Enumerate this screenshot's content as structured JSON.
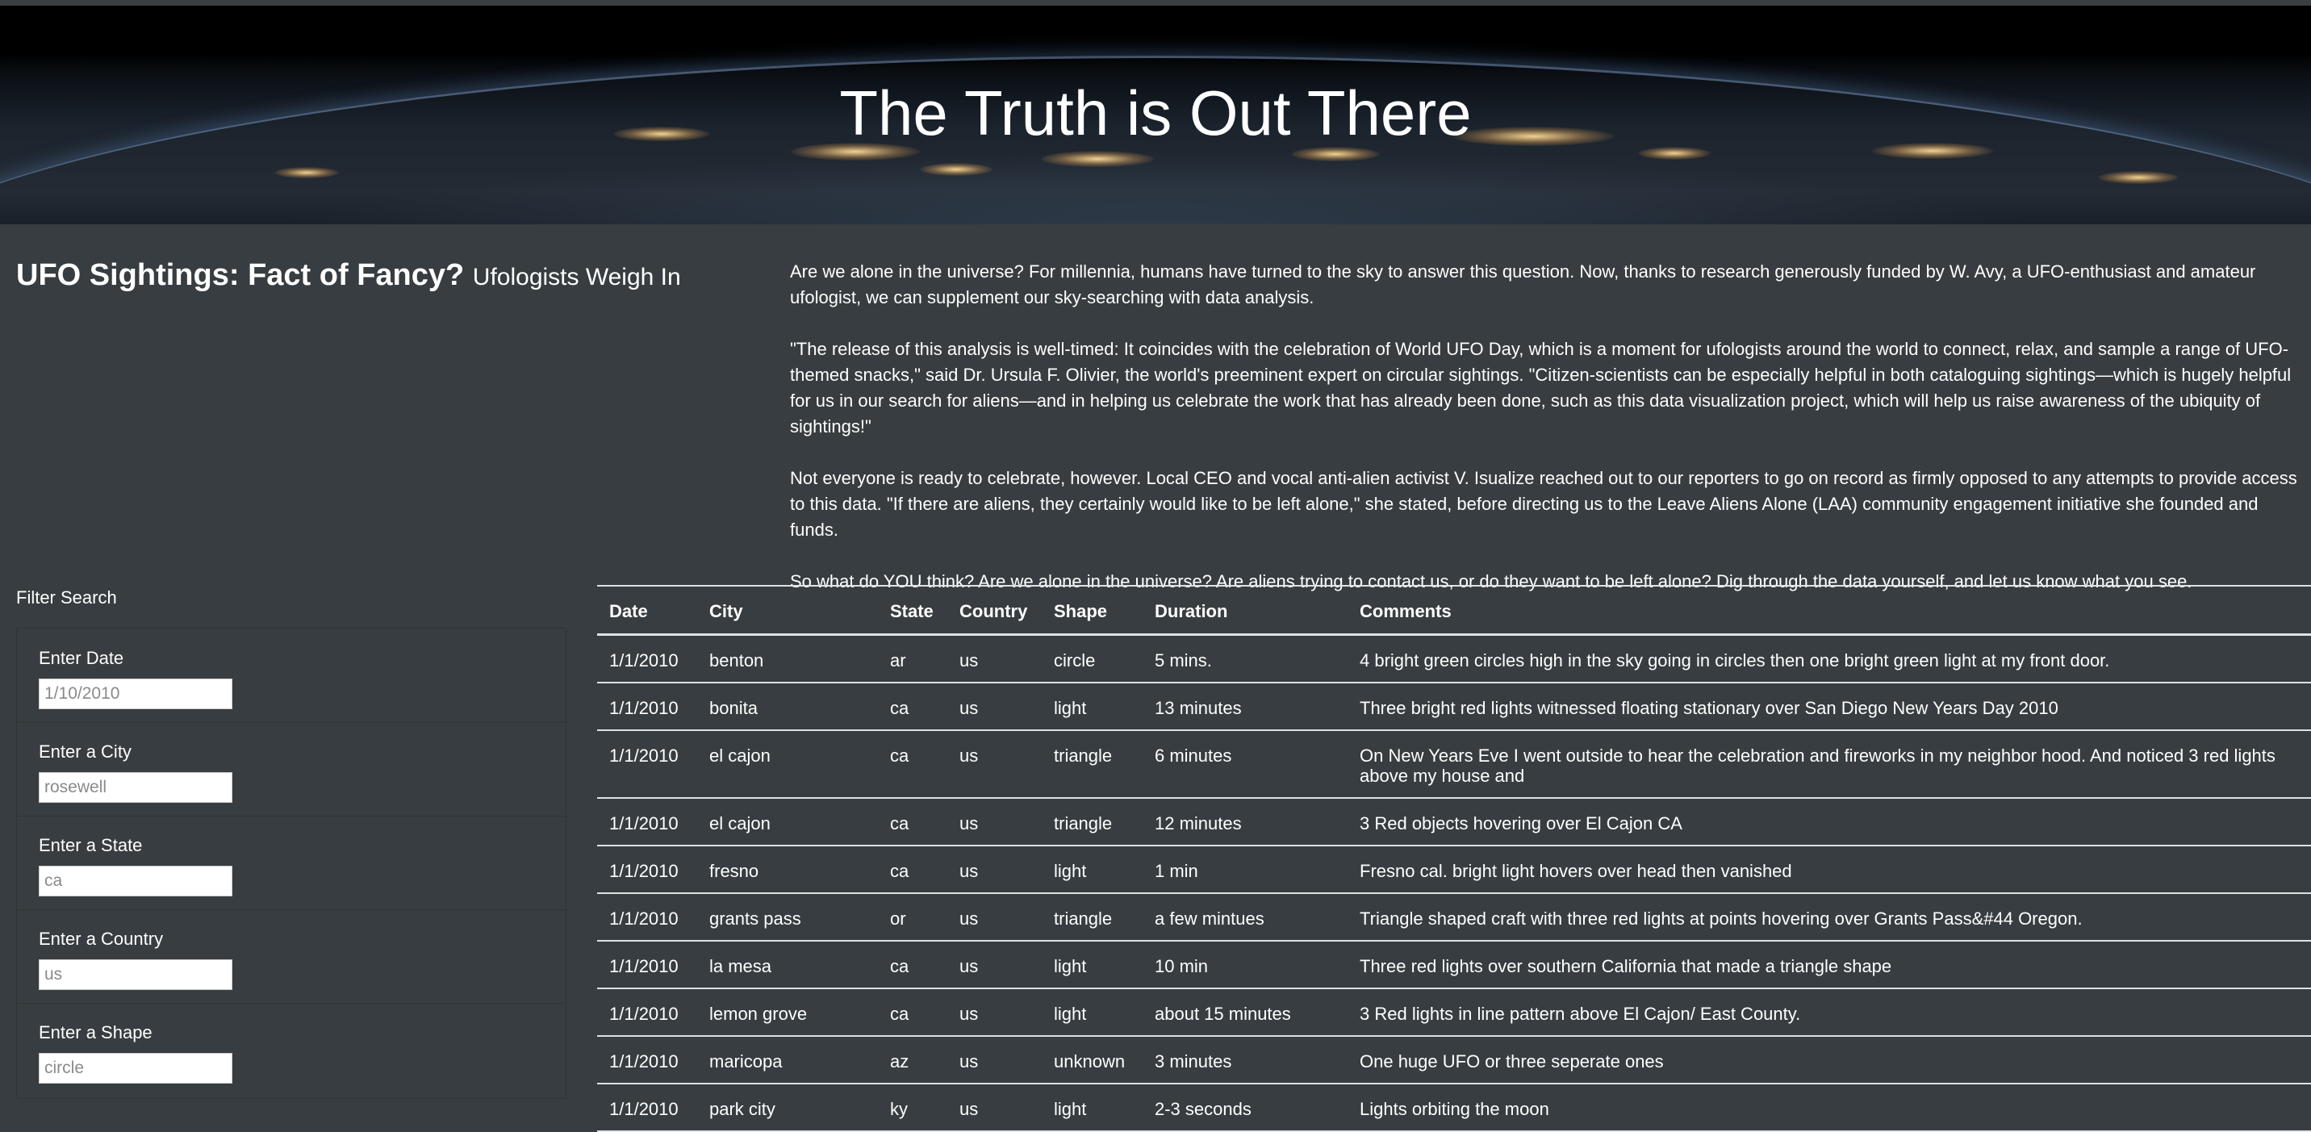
{
  "hero": {
    "title": "The Truth is Out There"
  },
  "headline": {
    "main": "UFO Sightings: Fact of Fancy?",
    "sub": "Ufologists Weigh In"
  },
  "article": {
    "paragraphs": [
      "Are we alone in the universe? For millennia, humans have turned to the sky to answer this question. Now, thanks to research generously funded by W. Avy, a UFO-enthusiast and amateur ufologist, we can supplement our sky-searching with data analysis.",
      "\"The release of this analysis is well-timed: It coincides with the celebration of World UFO Day, which is a moment for ufologists around the world to connect, relax, and sample a range of UFO-themed snacks,\" said Dr. Ursula F. Olivier, the world's preeminent expert on circular sightings. \"Citizen-scientists can be especially helpful in both cataloguing sightings—which is hugely helpful for us in our search for aliens—and in helping us celebrate the work that has already been done, such as this data visualization project, which will help us raise awareness of the ubiquity of sightings!\"",
      "Not everyone is ready to celebrate, however. Local CEO and vocal anti-alien activist V. Isualize reached out to our reporters to go on record as firmly opposed to any attempts to provide access to this data. \"If there are aliens, they certainly would like to be left alone,\" she stated, before directing us to the Leave Aliens Alone (LAA) community engagement initiative she founded and funds.",
      "So what do YOU think? Are we alone in the universe? Are aliens trying to contact us, or do they want to be left alone? Dig through the data yourself, and let us know what you see."
    ]
  },
  "filters": {
    "title": "Filter Search",
    "items": [
      {
        "label": "Enter Date",
        "placeholder": "1/10/2010"
      },
      {
        "label": "Enter a City",
        "placeholder": "rosewell"
      },
      {
        "label": "Enter a State",
        "placeholder": "ca"
      },
      {
        "label": "Enter a Country",
        "placeholder": "us"
      },
      {
        "label": "Enter a Shape",
        "placeholder": "circle"
      }
    ]
  },
  "table": {
    "headers": [
      "Date",
      "City",
      "State",
      "Country",
      "Shape",
      "Duration",
      "Comments"
    ],
    "rows": [
      [
        "1/1/2010",
        "benton",
        "ar",
        "us",
        "circle",
        "5 mins.",
        "4 bright green circles high in the sky going in circles then one bright green light at my front door."
      ],
      [
        "1/1/2010",
        "bonita",
        "ca",
        "us",
        "light",
        "13 minutes",
        "Three bright red lights witnessed floating stationary over San Diego New Years Day 2010"
      ],
      [
        "1/1/2010",
        "el cajon",
        "ca",
        "us",
        "triangle",
        "6 minutes",
        "On New Years Eve I went outside to hear the celebration and fireworks in my neighbor hood. And noticed 3 red lights above my house and"
      ],
      [
        "1/1/2010",
        "el cajon",
        "ca",
        "us",
        "triangle",
        "12 minutes",
        "3 Red objects hovering over El Cajon CA"
      ],
      [
        "1/1/2010",
        "fresno",
        "ca",
        "us",
        "light",
        "1 min",
        "Fresno cal. bright light hovers over head then vanished"
      ],
      [
        "1/1/2010",
        "grants pass",
        "or",
        "us",
        "triangle",
        "a few mintues",
        "Triangle shaped craft with three red lights at points hovering over Grants Pass&#44 Oregon."
      ],
      [
        "1/1/2010",
        "la mesa",
        "ca",
        "us",
        "light",
        "10 min",
        "Three red lights over southern California that made a triangle shape"
      ],
      [
        "1/1/2010",
        "lemon grove",
        "ca",
        "us",
        "light",
        "about 15 minutes",
        "3 Red lights in line pattern above El Cajon/ East County."
      ],
      [
        "1/1/2010",
        "maricopa",
        "az",
        "us",
        "unknown",
        "3 minutes",
        "One huge UFO or three seperate ones"
      ],
      [
        "1/1/2010",
        "park city",
        "ky",
        "us",
        "light",
        "2-3 seconds",
        "Lights orbiting the moon"
      ]
    ]
  }
}
